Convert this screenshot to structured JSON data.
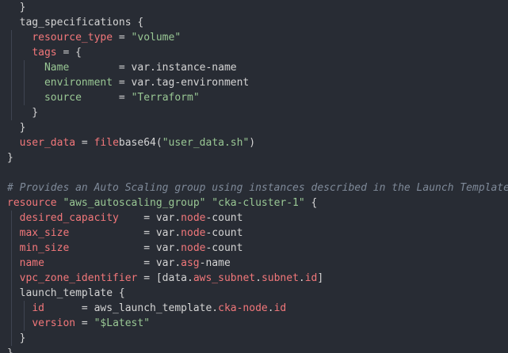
{
  "colors": {
    "background": "#282c34",
    "default_text": "#d4d4d4",
    "property": "#f2777a",
    "string": "#99c794",
    "keyword": "#f2777a",
    "comment": "#7f8a99",
    "function": "#ffcc66",
    "guide": "#3e4451"
  },
  "lines": [
    [
      {
        "t": "  }",
        "c": "default_text"
      }
    ],
    [
      {
        "t": "  tag_specifications {",
        "c": "default_text"
      }
    ],
    [
      {
        "t": "    ",
        "c": "default_text"
      },
      {
        "t": "resource_type",
        "c": "property"
      },
      {
        "t": " = ",
        "c": "default_text"
      },
      {
        "t": "\"volume\"",
        "c": "string"
      }
    ],
    [
      {
        "t": "    ",
        "c": "default_text"
      },
      {
        "t": "tags",
        "c": "property"
      },
      {
        "t": " = {",
        "c": "default_text"
      }
    ],
    [
      {
        "t": "      ",
        "c": "default_text"
      },
      {
        "t": "Name",
        "c": "string"
      },
      {
        "t": "        = var.instance-name",
        "c": "default_text"
      }
    ],
    [
      {
        "t": "      ",
        "c": "default_text"
      },
      {
        "t": "environment",
        "c": "string"
      },
      {
        "t": " = var.tag-environment",
        "c": "default_text"
      }
    ],
    [
      {
        "t": "      ",
        "c": "default_text"
      },
      {
        "t": "source",
        "c": "string"
      },
      {
        "t": "      = ",
        "c": "default_text"
      },
      {
        "t": "\"Terraform\"",
        "c": "string"
      }
    ],
    [
      {
        "t": "    }",
        "c": "default_text"
      }
    ],
    [
      {
        "t": "  }",
        "c": "default_text"
      }
    ],
    [
      {
        "t": "  ",
        "c": "default_text"
      },
      {
        "t": "user_data",
        "c": "property"
      },
      {
        "t": " = ",
        "c": "default_text"
      },
      {
        "t": "file",
        "c": "property"
      },
      {
        "t": "base64(",
        "c": "default_text"
      },
      {
        "t": "\"user_data.sh\"",
        "c": "string"
      },
      {
        "t": ")",
        "c": "default_text"
      }
    ],
    [
      {
        "t": "}",
        "c": "default_text"
      }
    ],
    [
      {
        "t": "",
        "c": "default_text"
      }
    ],
    [
      {
        "t": "# Provides an Auto Scaling group using instances described in the Launch Template",
        "c": "comment"
      }
    ],
    [
      {
        "t": "resource",
        "c": "keyword"
      },
      {
        "t": " ",
        "c": "default_text"
      },
      {
        "t": "\"aws_autoscaling_group\"",
        "c": "string"
      },
      {
        "t": " ",
        "c": "default_text"
      },
      {
        "t": "\"cka-cluster-1\"",
        "c": "string"
      },
      {
        "t": " {",
        "c": "default_text"
      }
    ],
    [
      {
        "t": "  ",
        "c": "default_text"
      },
      {
        "t": "desired_capacity",
        "c": "property"
      },
      {
        "t": "    = var.",
        "c": "default_text"
      },
      {
        "t": "node",
        "c": "property"
      },
      {
        "t": "-count",
        "c": "default_text"
      }
    ],
    [
      {
        "t": "  ",
        "c": "default_text"
      },
      {
        "t": "max_size",
        "c": "property"
      },
      {
        "t": "            = var.",
        "c": "default_text"
      },
      {
        "t": "node",
        "c": "property"
      },
      {
        "t": "-count",
        "c": "default_text"
      }
    ],
    [
      {
        "t": "  ",
        "c": "default_text"
      },
      {
        "t": "min_size",
        "c": "property"
      },
      {
        "t": "            = var.",
        "c": "default_text"
      },
      {
        "t": "node",
        "c": "property"
      },
      {
        "t": "-count",
        "c": "default_text"
      }
    ],
    [
      {
        "t": "  ",
        "c": "default_text"
      },
      {
        "t": "name",
        "c": "property"
      },
      {
        "t": "                = var.",
        "c": "default_text"
      },
      {
        "t": "asg",
        "c": "property"
      },
      {
        "t": "-name",
        "c": "default_text"
      }
    ],
    [
      {
        "t": "  ",
        "c": "default_text"
      },
      {
        "t": "vpc_zone_identifier",
        "c": "property"
      },
      {
        "t": " = [data.",
        "c": "default_text"
      },
      {
        "t": "aws_subnet",
        "c": "property"
      },
      {
        "t": ".",
        "c": "default_text"
      },
      {
        "t": "subnet",
        "c": "property"
      },
      {
        "t": ".",
        "c": "default_text"
      },
      {
        "t": "id",
        "c": "property"
      },
      {
        "t": "]",
        "c": "default_text"
      }
    ],
    [
      {
        "t": "  launch_template {",
        "c": "default_text"
      }
    ],
    [
      {
        "t": "    ",
        "c": "default_text"
      },
      {
        "t": "id",
        "c": "property"
      },
      {
        "t": "      = aws_launch_template.",
        "c": "default_text"
      },
      {
        "t": "cka-node",
        "c": "property"
      },
      {
        "t": ".",
        "c": "default_text"
      },
      {
        "t": "id",
        "c": "property"
      }
    ],
    [
      {
        "t": "    ",
        "c": "default_text"
      },
      {
        "t": "version",
        "c": "property"
      },
      {
        "t": " = ",
        "c": "default_text"
      },
      {
        "t": "\"$Latest\"",
        "c": "string"
      }
    ],
    [
      {
        "t": "  }",
        "c": "default_text"
      }
    ],
    [
      {
        "t": "}",
        "c": "default_text"
      }
    ]
  ]
}
